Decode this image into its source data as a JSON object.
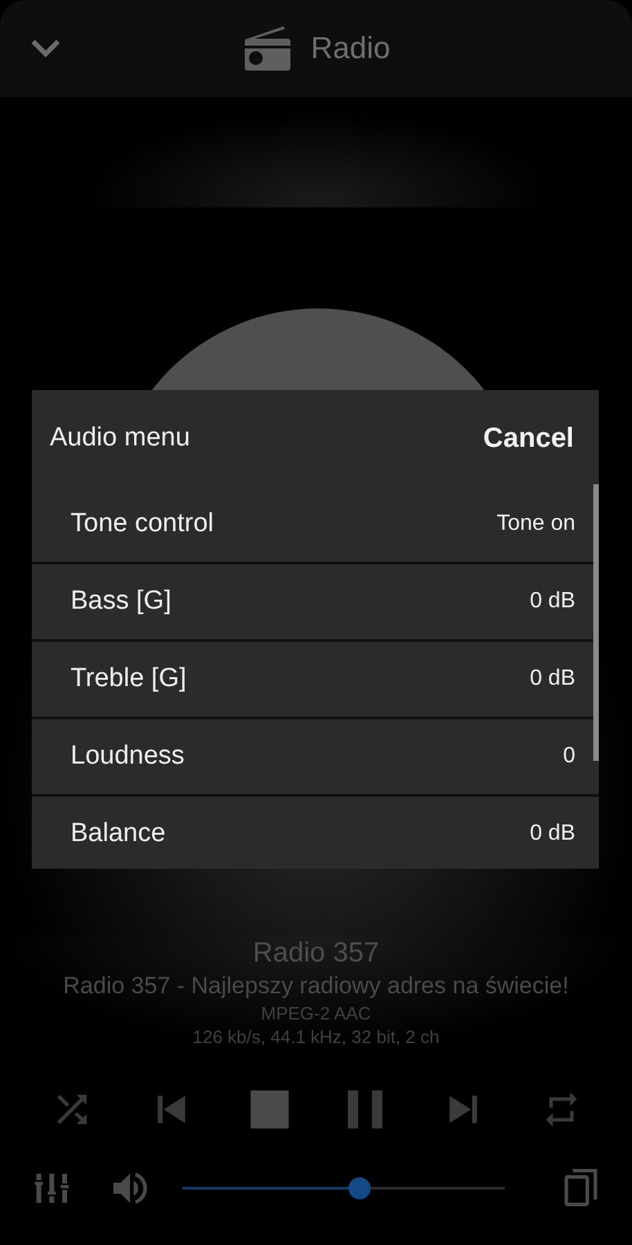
{
  "header": {
    "title": "Radio"
  },
  "station": {
    "name": "Radio 357",
    "description": "Radio 357 - Najlepszy radiowy adres na świecie!",
    "codec": "MPEG-2 AAC",
    "format": "126 kb/s, 44.1 kHz, 32 bit, 2 ch"
  },
  "transport": [
    {
      "kind": "shuffle"
    },
    {
      "kind": "previous"
    },
    {
      "kind": "stop"
    },
    {
      "kind": "pause"
    },
    {
      "kind": "next"
    },
    {
      "kind": "repeat"
    }
  ],
  "volume": {
    "level": 0.55
  },
  "dialog": {
    "title": "Audio menu",
    "cancel": "Cancel",
    "items": [
      {
        "label": "Tone control",
        "value": "Tone on"
      },
      {
        "label": "Bass [G]",
        "value": "0 dB"
      },
      {
        "label": "Treble [G]",
        "value": "0 dB"
      },
      {
        "label": "Loudness",
        "value": "0"
      },
      {
        "label": "Balance",
        "value": "0 dB"
      }
    ]
  }
}
